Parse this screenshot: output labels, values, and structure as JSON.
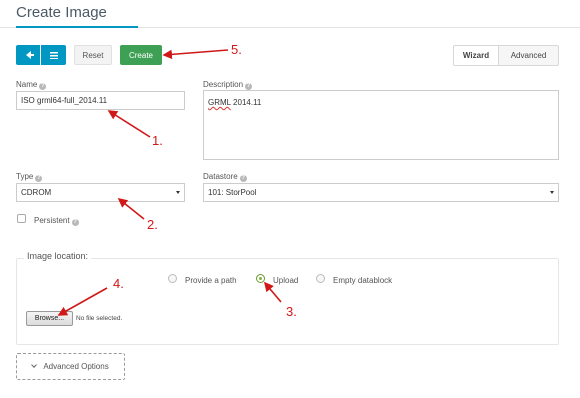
{
  "header": {
    "title": "Create Image"
  },
  "toolbar": {
    "back_icon": "arrow-left-icon",
    "list_icon": "list-icon",
    "reset_label": "Reset",
    "create_label": "Create",
    "wizard_label": "Wizard",
    "advanced_label": "Advanced"
  },
  "form": {
    "name_label": "Name",
    "name_value": "ISO grml64-full_2014.11",
    "description_label": "Description",
    "description_value_spell": "GRML",
    "description_value_rest": " 2014.11",
    "type_label": "Type",
    "type_value": "CDROM",
    "datastore_label": "Datastore",
    "datastore_value": "101: StorPool",
    "persistent_label": "Persistent",
    "help_glyph": "?"
  },
  "image_location": {
    "legend": "Image location:",
    "options": [
      "Provide a path",
      "Upload",
      "Empty datablock"
    ],
    "selected": "Upload",
    "browse_label": "Browse...",
    "file_status": "No file selected."
  },
  "advanced_options": {
    "label": "Advanced Options"
  },
  "annotations": [
    "1.",
    "2.",
    "3.",
    "4.",
    "5."
  ],
  "colors": {
    "primary": "#0098c3",
    "create": "#3ea054",
    "annotation": "#d01818"
  }
}
